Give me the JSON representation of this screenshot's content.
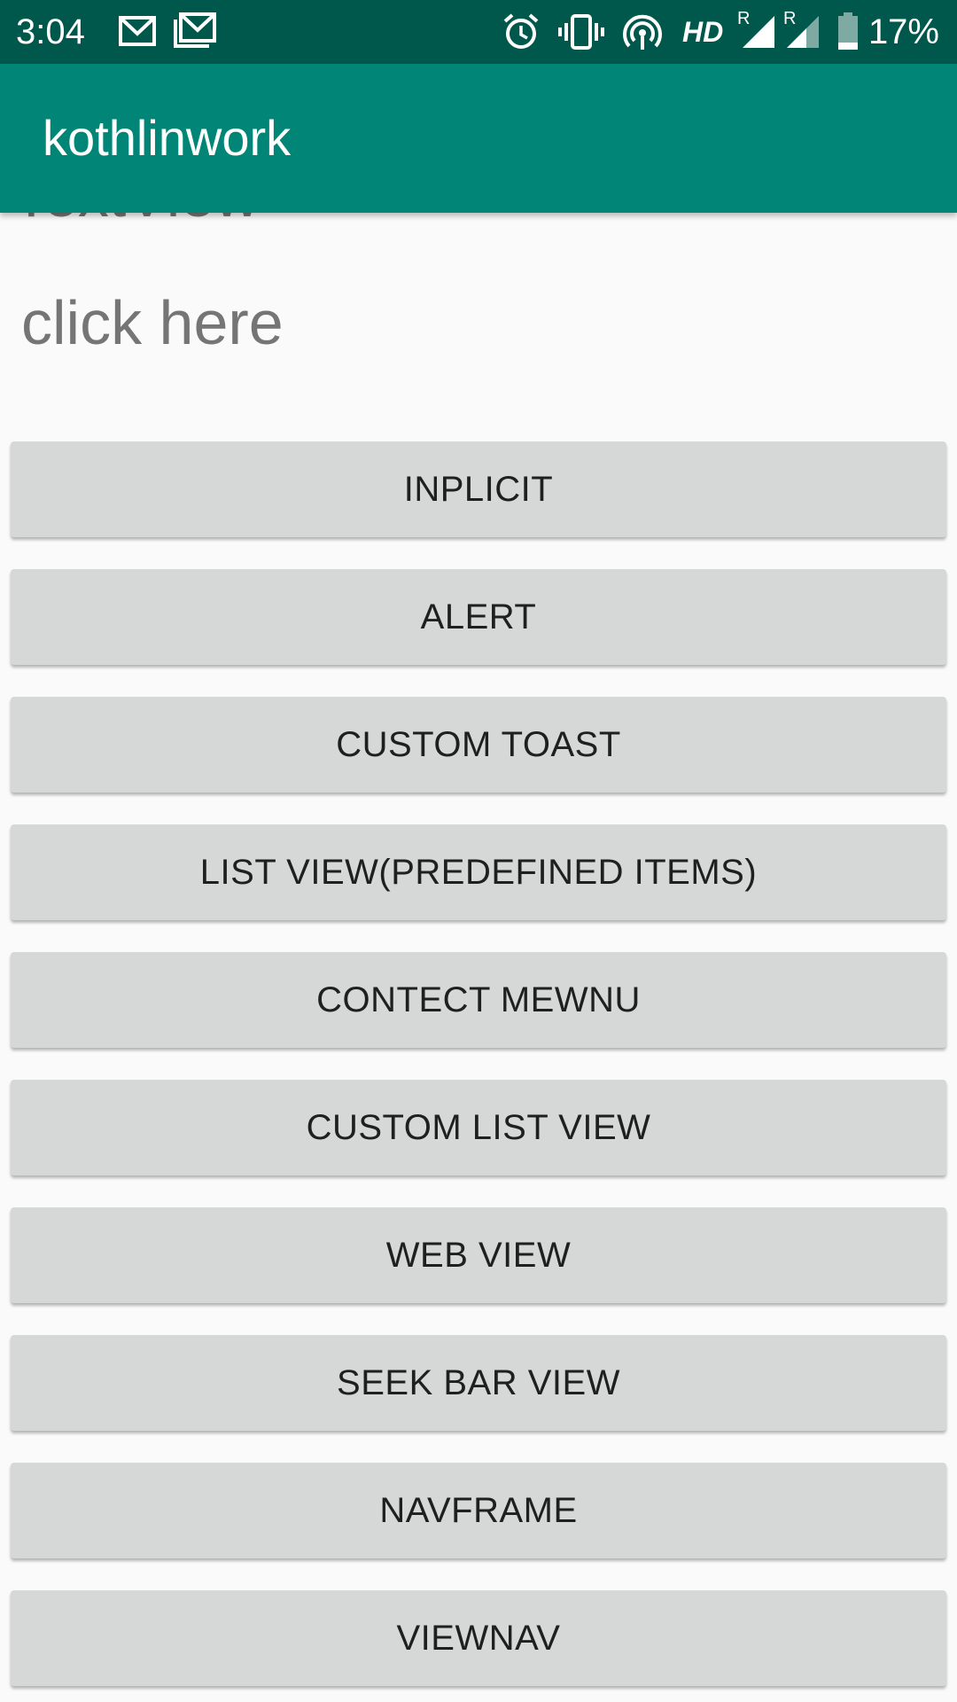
{
  "status_bar": {
    "time": "3:04",
    "network_label": "HD",
    "roaming_marker": "R",
    "battery_percent": "17%",
    "icons": [
      "gmail-icon",
      "gmail-icon",
      "alarm-icon",
      "vibrate-icon",
      "hotspot-icon",
      "signal-icon",
      "signal-icon",
      "battery-icon"
    ]
  },
  "app_bar": {
    "title": "kothlinwork"
  },
  "main": {
    "textview_label": "TextView",
    "click_label": "click here",
    "buttons": [
      {
        "label": "INPLICIT"
      },
      {
        "label": "ALERT"
      },
      {
        "label": "CUSTOM TOAST"
      },
      {
        "label": "LIST VIEW(PREDEFINED ITEMS)"
      },
      {
        "label": "CONTECT MEWNU"
      },
      {
        "label": "CUSTOM LIST VIEW"
      },
      {
        "label": "WEB VIEW"
      },
      {
        "label": "SEEK BAR VIEW"
      },
      {
        "label": "NAVFRAME"
      },
      {
        "label": "VIEWNAV"
      }
    ]
  },
  "colors": {
    "status_bar": "#00574b",
    "app_bar": "#008577",
    "background": "#fafafa",
    "button": "#d6d7d7",
    "button_text": "#1f1f1f",
    "secondary_text": "#757575"
  }
}
